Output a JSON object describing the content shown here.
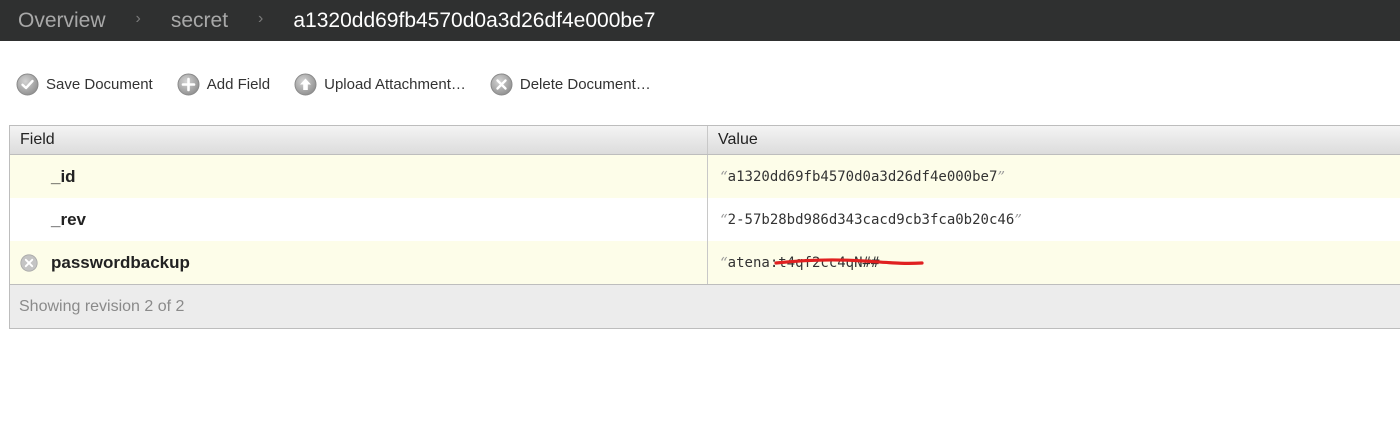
{
  "breadcrumb": {
    "items": [
      {
        "label": "Overview"
      },
      {
        "label": "secret"
      },
      {
        "label": "a1320dd69fb4570d0a3d26df4e000be7"
      }
    ],
    "separator": "›"
  },
  "toolbar": {
    "save_label": "Save Document",
    "add_field_label": "Add Field",
    "upload_label": "Upload Attachment…",
    "delete_label": "Delete Document…"
  },
  "table": {
    "headers": {
      "field": "Field",
      "value": "Value"
    },
    "rows": [
      {
        "field": "_id",
        "value": "a1320dd69fb4570d0a3d26df4e000be7",
        "deletable": false
      },
      {
        "field": "_rev",
        "value": "2-57b28bd986d343cacd9cb3fca0b20c46",
        "deletable": false
      },
      {
        "field": "passwordbackup",
        "value_visible": "atena:",
        "value_redacted": "t4qf2cc4qN##",
        "deletable": true
      }
    ],
    "quote_open": "“",
    "quote_close": "”",
    "footer": "Showing revision 2 of 2"
  },
  "colors": {
    "topbar_bg": "#2f3030",
    "row_highlight": "#fdfde9",
    "redaction": "#e02020",
    "icon_gray": "#9c9c9c"
  },
  "icons": {
    "save": "check-circle-icon",
    "add_field": "plus-circle-icon",
    "upload": "arrow-up-circle-icon",
    "delete": "x-circle-icon"
  }
}
